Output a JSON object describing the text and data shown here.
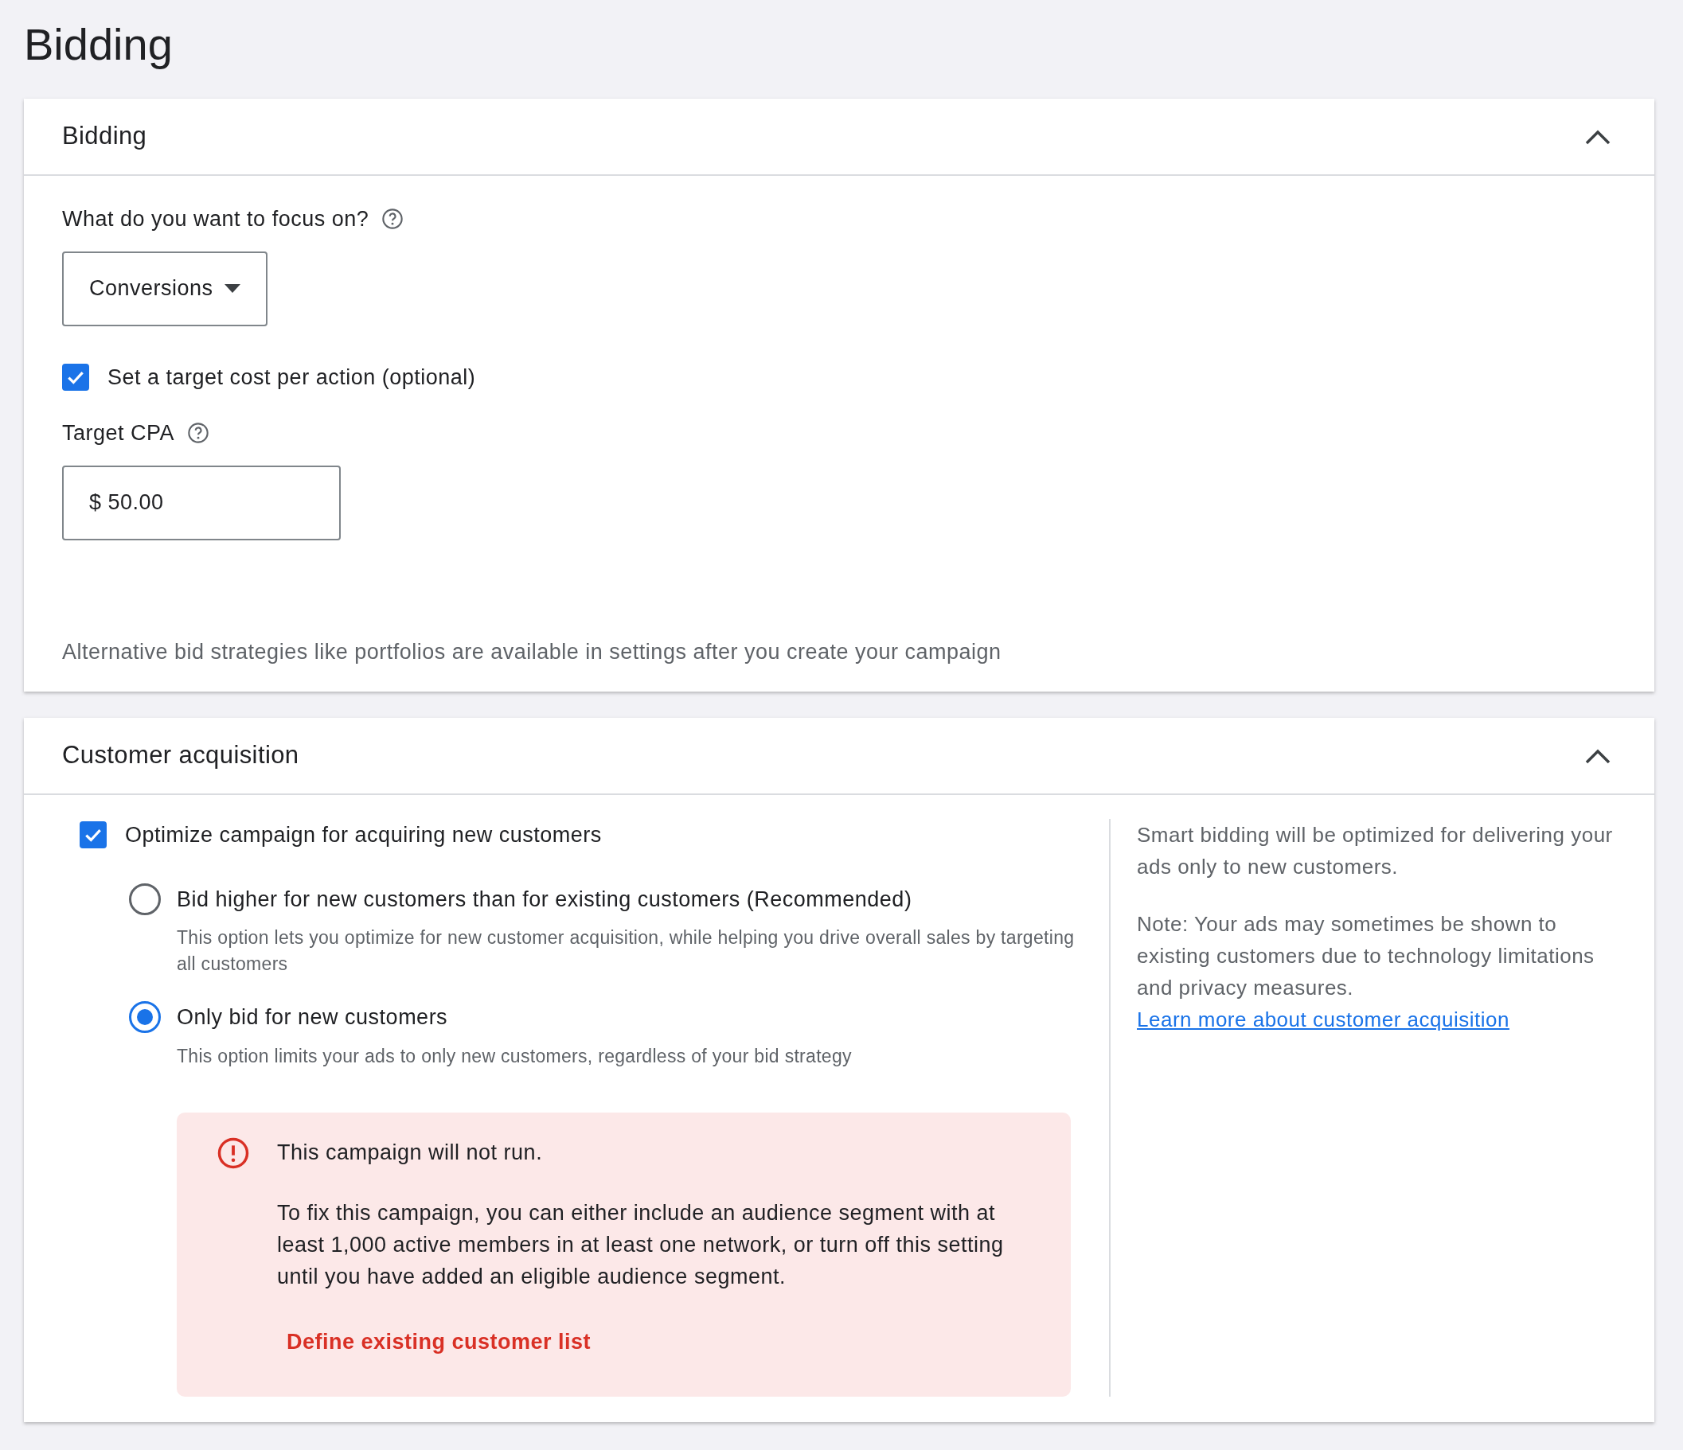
{
  "page_title": "Bidding",
  "bidding_card": {
    "title": "Bidding",
    "expanded": true,
    "focus_label": "What do you want to focus on?",
    "focus_dropdown": {
      "value": "Conversions"
    },
    "target_checkbox": {
      "label": "Set a target cost per action (optional)",
      "checked": true
    },
    "target_cpa": {
      "label": "Target CPA",
      "value": "$ 50.00"
    },
    "note": "Alternative bid strategies like portfolios are available in settings after you create your campaign"
  },
  "customer_card": {
    "title": "Customer acquisition",
    "expanded": true,
    "optimize_checkbox": {
      "label": "Optimize campaign for acquiring new customers",
      "checked": true
    },
    "options": [
      {
        "label": "Bid higher for new customers than for existing customers (Recommended)",
        "description": "This option lets you optimize for new customer acquisition, while helping you drive overall sales by targeting all customers",
        "selected": false
      },
      {
        "label": "Only bid for new customers",
        "description": "This option limits your ads to only new customers, regardless of your bid strategy",
        "selected": true
      }
    ],
    "error": {
      "title": "This campaign will not run.",
      "body": "To fix this campaign, you can either include an audience segment with at least 1,000 active members in at least one network, or turn off this setting until you have added an eligible audience segment.",
      "action": "Define existing customer list"
    },
    "side_text": "Smart bidding will be optimized for delivering your ads only to new customers.",
    "side_note": "Note: Your ads may sometimes be shown to existing customers due to technology limitations and privacy measures.",
    "side_link": "Learn more about customer acquisition"
  }
}
